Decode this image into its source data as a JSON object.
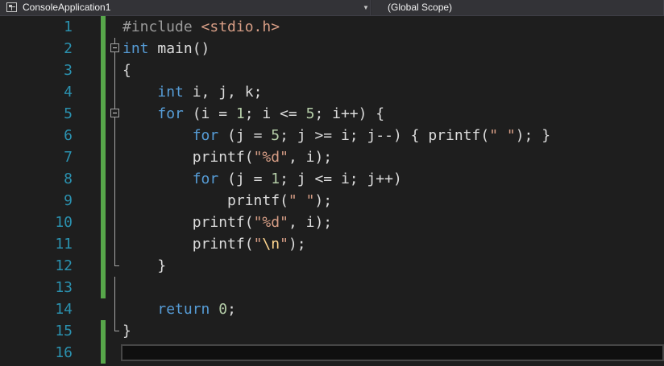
{
  "navbar": {
    "project": "ConsoleApplication1",
    "scope": "(Global Scope)"
  },
  "colors": {
    "background": "#1e1e1e",
    "line_number": "#2b91af",
    "keyword": "#569cd6",
    "string": "#d69d85",
    "number": "#b5cea8",
    "change_bar": "#57a64a"
  },
  "editor": {
    "line_numbers": [
      "1",
      "2",
      "3",
      "4",
      "5",
      "6",
      "7",
      "8",
      "9",
      "10",
      "11",
      "12",
      "13",
      "14",
      "15",
      "16"
    ],
    "tokens": {
      "l1_directive": "#include",
      "l1_header": " <stdio.h>",
      "l2_type": "int",
      "l2_rest": " main()",
      "l3": "{",
      "l4_type": "int",
      "l4_rest": " i, j, k;",
      "l5_kw": "for",
      "l5_a": " (i = ",
      "l5_n1": "1",
      "l5_b": "; i <= ",
      "l5_n2": "5",
      "l5_c": "; i++) {",
      "l6_kw": "for",
      "l6_a": " (j = ",
      "l6_n1": "5",
      "l6_b": "; j >= i; j--) { printf(",
      "l6_s": "\" \"",
      "l6_c": "); }",
      "l7_a": "printf(",
      "l7_s1": "\"",
      "l7_fmt": "%d",
      "l7_s2": "\"",
      "l7_b": ", i);",
      "l8_kw": "for",
      "l8_a": " (j = ",
      "l8_n1": "1",
      "l8_b": "; j <= i; j++)",
      "l9_a": "printf(",
      "l9_s": "\" \"",
      "l9_b": ");",
      "l10_a": "printf(",
      "l10_s1": "\"",
      "l10_fmt": "%d",
      "l10_s2": "\"",
      "l10_b": ", i);",
      "l11_a": "printf(",
      "l11_s1": "\"",
      "l11_esc": "\\n",
      "l11_s2": "\"",
      "l11_b": ");",
      "l12": "}",
      "l14_kw": "return",
      "l14_sp": " ",
      "l14_n": "0",
      "l14_b": ";",
      "l15": "}"
    }
  }
}
